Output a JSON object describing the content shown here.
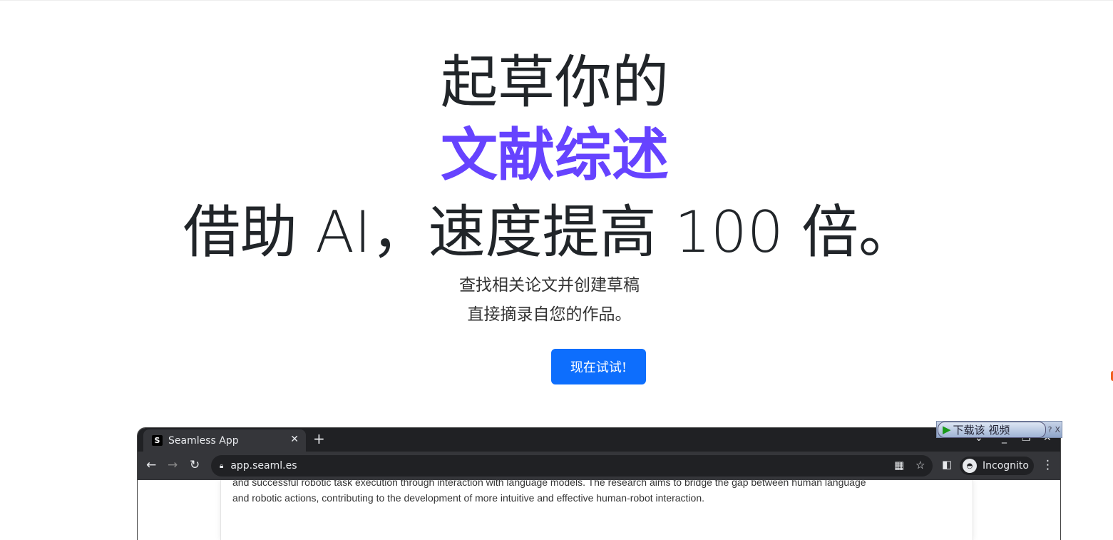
{
  "hero": {
    "line1": "起草你的",
    "line2": "文献综述",
    "line3": "借助 AI，速度提高 100 倍。",
    "sub1": "查找相关论文并创建草稿",
    "sub2": "直接摘录自您的作品。",
    "cta": "现在试试!"
  },
  "colors": {
    "accent": "#6643ff",
    "button": "#0d6efd"
  },
  "browser": {
    "tab_title": "Seamless App",
    "favicon": "S",
    "url": "app.seaml.es",
    "profile": "Incognito",
    "content_lines": [
      "and successful robotic task execution through interaction with language models. The research aims to bridge the gap between human language",
      "and robotic actions, contributing to the development of more intuitive and effective human-robot interaction."
    ]
  },
  "overlay": {
    "download_label": "下载该 视频",
    "help": "?",
    "close": "X"
  }
}
